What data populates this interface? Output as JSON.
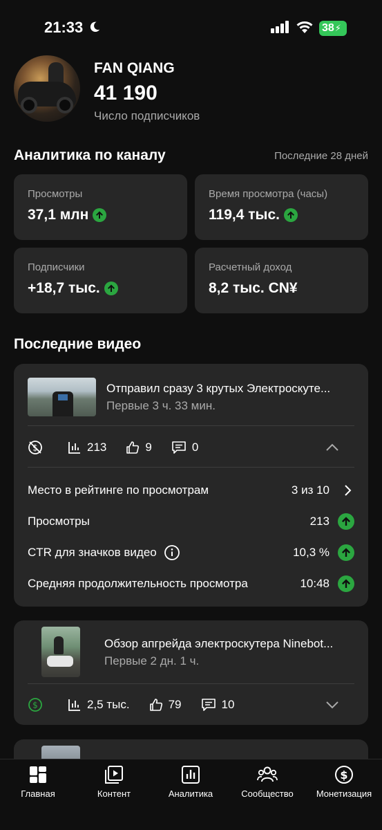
{
  "status": {
    "time": "21:33",
    "battery": "38"
  },
  "profile": {
    "name": "FAN QIANG",
    "subscribers": "41 190",
    "subscribers_label": "Число подписчиков"
  },
  "analytics": {
    "title": "Аналитика по каналу",
    "period": "Последние 28 дней",
    "cards": [
      {
        "label": "Просмотры",
        "value": "37,1 млн",
        "trend": "up"
      },
      {
        "label": "Время просмотра (часы)",
        "value": "119,4 тыс.",
        "trend": "up"
      },
      {
        "label": "Подписчики",
        "value": "+18,7 тыс.",
        "trend": "up"
      },
      {
        "label": "Расчетный доход",
        "value": "8,2 тыс. CN¥",
        "trend": "none"
      }
    ]
  },
  "recent": {
    "title": "Последние видео",
    "videos": [
      {
        "title": "Отправил сразу 3 крутых Электроскуте...",
        "sub": "Первые 3 ч. 33 мин.",
        "views": "213",
        "likes": "9",
        "comments": "0",
        "monetization_icon": "monetization-off-icon",
        "details": [
          {
            "label": "Место в рейтинге по просмотрам",
            "value": "3 из 10"
          },
          {
            "label": "Просмотры",
            "value": "213"
          },
          {
            "label": "CTR для значков видео",
            "value": "10,3 %"
          },
          {
            "label": "Средняя продолжительность просмотра",
            "value": "10:48"
          }
        ]
      },
      {
        "title": "Обзор апгрейда электроскутера Ninebot...",
        "sub": "Первые 2 дн. 1 ч.",
        "views": "2,5 тыс.",
        "likes": "79",
        "comments": "10",
        "monetization_icon": "monetization-on-icon"
      }
    ]
  },
  "nav": [
    {
      "label": "Главная",
      "icon": "home-grid-icon"
    },
    {
      "label": "Контент",
      "icon": "content-icon"
    },
    {
      "label": "Аналитика",
      "icon": "analytics-icon"
    },
    {
      "label": "Сообщество",
      "icon": "community-icon"
    },
    {
      "label": "Монетизация",
      "icon": "monetization-icon"
    }
  ],
  "colors": {
    "background": "#0f0f0f",
    "card": "#272727",
    "up_green": "#2ba640",
    "battery_green": "#34c759"
  }
}
